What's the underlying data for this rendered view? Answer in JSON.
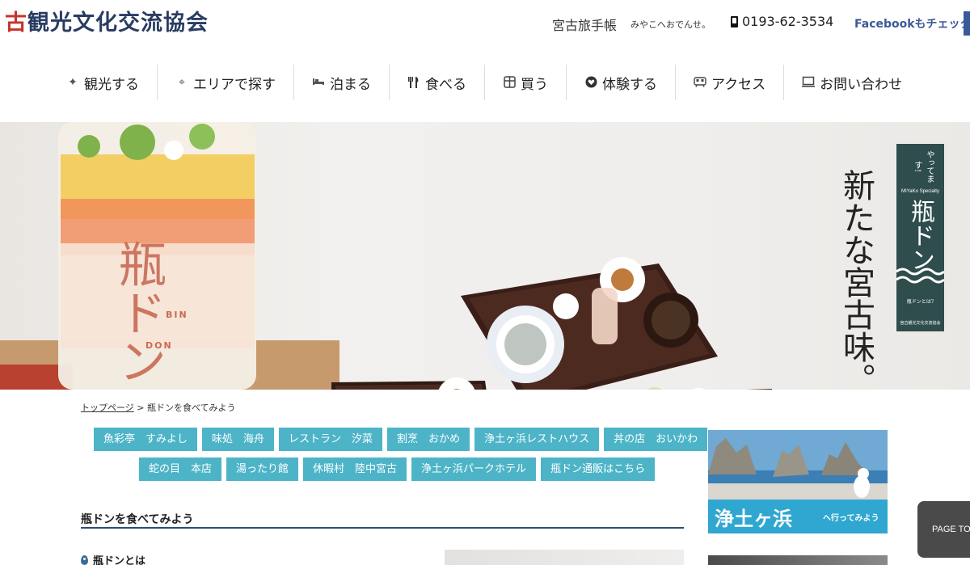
{
  "header": {
    "site_title_red": "古",
    "site_title_rest": "観光文化交流協会",
    "techo": "宮古旅手帳",
    "techo_sub": "みやこへおでんせ。",
    "phone": "0193-62-3534",
    "facebook": "Facebookもチェック"
  },
  "nav": {
    "items": [
      {
        "label": "観光する",
        "icon": "sparkle-icon"
      },
      {
        "label": "エリアで探す",
        "icon": "target-icon"
      },
      {
        "label": "泊まる",
        "icon": "bed-icon"
      },
      {
        "label": "食べる",
        "icon": "fork-knife-icon"
      },
      {
        "label": "買う",
        "icon": "gift-icon"
      },
      {
        "label": "体験する",
        "icon": "heart-icon"
      },
      {
        "label": "アクセス",
        "icon": "train-icon"
      },
      {
        "label": "お問い合わせ",
        "icon": "monitor-icon"
      }
    ]
  },
  "hero": {
    "vertical_text": "新たな宮古味。",
    "jar_title": "瓶ドン",
    "jar_bin": "BIN",
    "jar_don": "DON",
    "banner_top": "やってます!",
    "banner_brand": "MIYaKo Specialty",
    "banner_main": "瓶ドン",
    "banner_bottom": "瓶ドンとは?",
    "banner_org": "宮古観光文化交流協会"
  },
  "breadcrumb": {
    "home": "トップページ",
    "separator": ">",
    "current": "瓶ドンを食べてみよう"
  },
  "tags": {
    "row1": [
      "魚彩亭　すみよし",
      "味処　海舟",
      "レストラン　汐菜",
      "割烹　おかめ",
      "浄土ヶ浜レストハウス",
      "丼の店　おいかわ"
    ],
    "row2": [
      "蛇の目　本店",
      "湯ったり館",
      "休暇村　陸中宮古",
      "浄土ヶ浜パークホテル",
      "瓶ドン通販はこちら"
    ]
  },
  "section": {
    "heading": "瓶ドンを食べてみよう",
    "sub_heading": "瓶ドンとは"
  },
  "promo": {
    "title": "浄土ヶ浜",
    "sub": "へ行ってみよう"
  },
  "page_top": "PAGE TOP",
  "colors": {
    "tag_bg": "#4db4c8",
    "title_navy": "#2a3c62",
    "title_red": "#c8332c",
    "facebook": "#3b5998",
    "heading_rule": "#2a4d75"
  }
}
